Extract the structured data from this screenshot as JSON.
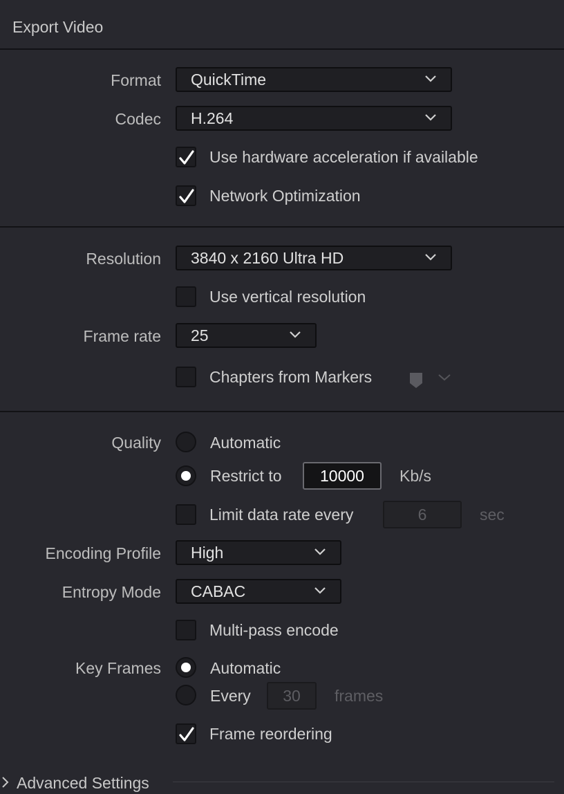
{
  "header": {
    "title": "Export Video"
  },
  "format": {
    "label": "Format",
    "value": "QuickTime"
  },
  "codec": {
    "label": "Codec",
    "value": "H.264"
  },
  "hw_accel": {
    "label": "Use hardware acceleration if available",
    "checked": true
  },
  "network_opt": {
    "label": "Network Optimization",
    "checked": true
  },
  "resolution": {
    "label": "Resolution",
    "value": "3840 x 2160 Ultra HD"
  },
  "vertical_res": {
    "label": "Use vertical resolution",
    "checked": false
  },
  "frame_rate": {
    "label": "Frame rate",
    "value": "25"
  },
  "chapters": {
    "label": "Chapters from Markers",
    "checked": false,
    "icon": "marker-icon"
  },
  "quality": {
    "label": "Quality",
    "automatic_label": "Automatic",
    "restrict_label": "Restrict to",
    "restrict_value": "10000",
    "restrict_unit": "Kb/s",
    "selected": "restrict"
  },
  "limit_rate": {
    "label": "Limit data rate every",
    "value": "6",
    "unit": "sec",
    "checked": false
  },
  "encoding_profile": {
    "label": "Encoding Profile",
    "value": "High"
  },
  "entropy_mode": {
    "label": "Entropy Mode",
    "value": "CABAC"
  },
  "multipass": {
    "label": "Multi-pass encode",
    "checked": false
  },
  "key_frames": {
    "label": "Key Frames",
    "automatic_label": "Automatic",
    "every_label": "Every",
    "every_value": "30",
    "every_unit": "frames",
    "selected": "automatic"
  },
  "frame_reordering": {
    "label": "Frame reordering",
    "checked": true
  },
  "advanced": {
    "label": "Advanced Settings"
  }
}
